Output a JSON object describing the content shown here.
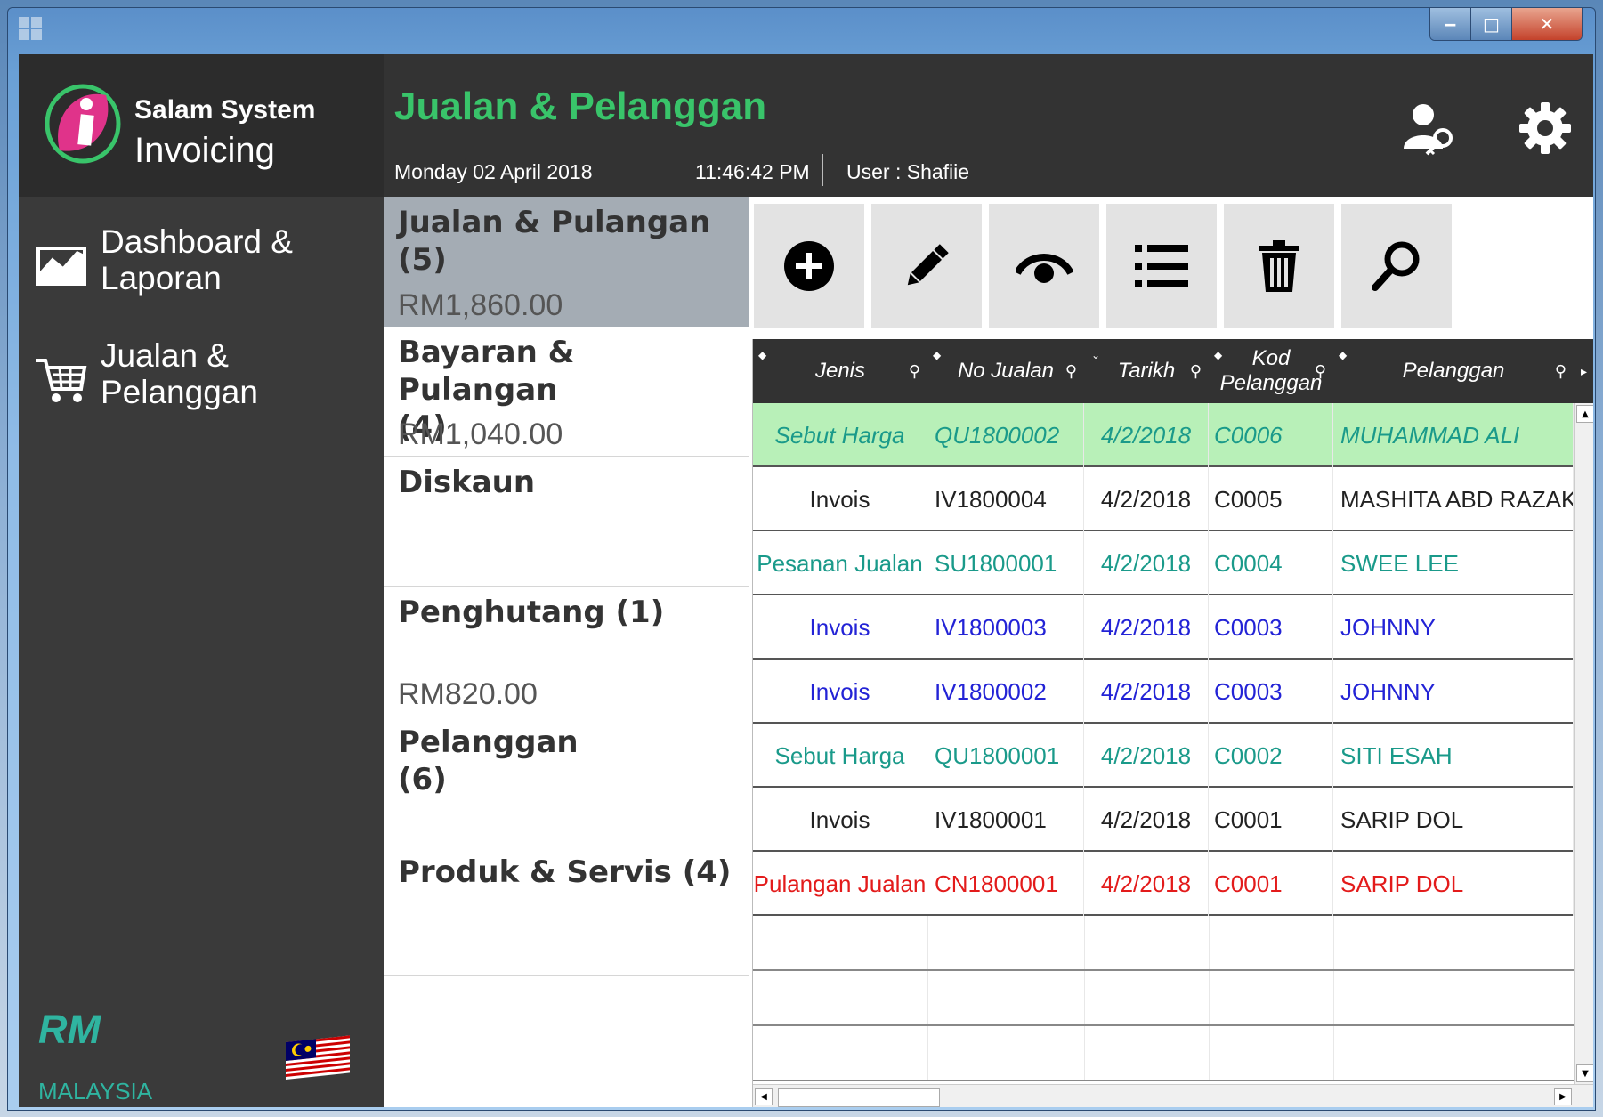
{
  "window": {
    "minimize": "‒",
    "maximize": "□",
    "close": "✕"
  },
  "logo": {
    "line1": "Salam System",
    "line2": "Invoicing"
  },
  "sidebar": {
    "items": [
      {
        "label": "Dashboard &\nLaporan",
        "icon": "chart-line-icon"
      },
      {
        "label": "Jualan &\nPelanggan",
        "icon": "shopping-cart-icon"
      }
    ],
    "currency": "RM",
    "country": "MALAYSIA"
  },
  "header": {
    "title": "Jualan & Pelanggan",
    "date": "Monday 02 April 2018",
    "time": "11:46:42 PM",
    "user": "User : Shafiie"
  },
  "summary": [
    {
      "title": "Jualan & Pulangan\n(5)",
      "amount": "RM1,860.00",
      "active": true
    },
    {
      "title": "Bayaran & Pulangan\n(4)",
      "amount": "RM1,040.00"
    },
    {
      "title": "Diskaun",
      "amount": ""
    },
    {
      "title": "Penghutang  (1)",
      "amount": "RM820.00"
    },
    {
      "title": "Pelanggan\n(6)",
      "amount": ""
    },
    {
      "title": "Produk & Servis  (4)",
      "amount": ""
    }
  ],
  "toolbar": [
    "add-icon",
    "edit-icon",
    "view-icon",
    "list-icon",
    "delete-icon",
    "search-icon"
  ],
  "grid": {
    "columns": [
      "Jenis",
      "No Jualan",
      "Tarikh",
      "Kod\nPelanggan",
      "Pelanggan"
    ],
    "rows": [
      {
        "jenis": "Sebut Harga",
        "no": "QU1800002",
        "tarikh": "4/2/2018",
        "kod": "C0006",
        "pelanggan": "MUHAMMAD ALI",
        "color": "#1a9a8a",
        "selected": true
      },
      {
        "jenis": "Invois",
        "no": "IV1800004",
        "tarikh": "4/2/2018",
        "kod": "C0005",
        "pelanggan": "MASHITA ABD RAZAK",
        "color": "#222222"
      },
      {
        "jenis": "Pesanan Jualan",
        "no": "SU1800001",
        "tarikh": "4/2/2018",
        "kod": "C0004",
        "pelanggan": "SWEE LEE",
        "color": "#1a9a8a"
      },
      {
        "jenis": "Invois",
        "no": "IV1800003",
        "tarikh": "4/2/2018",
        "kod": "C0003",
        "pelanggan": "JOHNNY",
        "color": "#2323d6"
      },
      {
        "jenis": "Invois",
        "no": "IV1800002",
        "tarikh": "4/2/2018",
        "kod": "C0003",
        "pelanggan": "JOHNNY",
        "color": "#2323d6"
      },
      {
        "jenis": "Sebut Harga",
        "no": "QU1800001",
        "tarikh": "4/2/2018",
        "kod": "C0002",
        "pelanggan": "SITI ESAH",
        "color": "#1a9a8a"
      },
      {
        "jenis": "Invois",
        "no": "IV1800001",
        "tarikh": "4/2/2018",
        "kod": "C0001",
        "pelanggan": "SARIP DOL",
        "color": "#222222"
      },
      {
        "jenis": "Pulangan Jualan",
        "no": "CN1800001",
        "tarikh": "4/2/2018",
        "kod": "C0001",
        "pelanggan": "SARIP DOL",
        "color": "#e31b1b"
      }
    ]
  }
}
